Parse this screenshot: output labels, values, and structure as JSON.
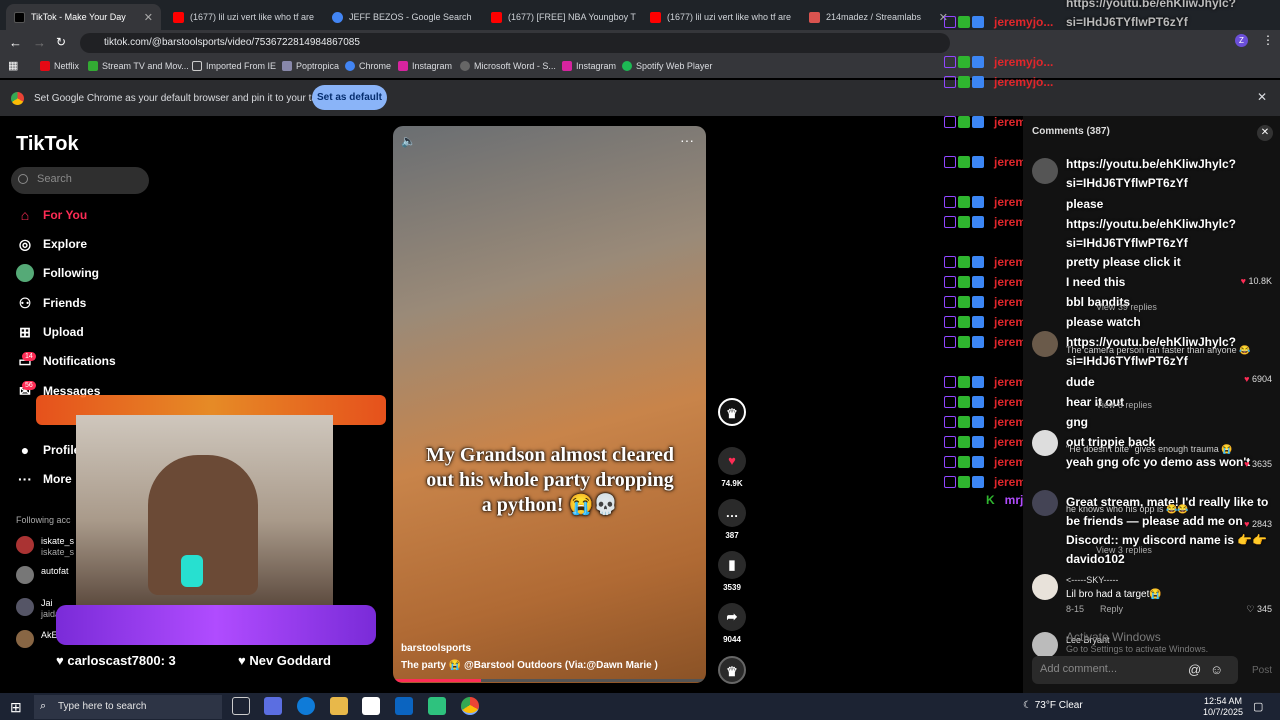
{
  "browser": {
    "tabs": [
      {
        "title": "TikTok - Make Your Day",
        "active": true
      },
      {
        "title": "(1677) lil uzi vert like who tf are"
      },
      {
        "title": "JEFF BEZOS - Google Search"
      },
      {
        "title": "(1677) [FREE] NBA Youngboy T"
      },
      {
        "title": "(1677) lil uzi vert like who tf are"
      },
      {
        "title": "214madez / Streamlabs"
      }
    ],
    "url": "tiktok.com/@barstoolsports/video/7536722814984867085",
    "bookmarks": [
      "Netflix",
      "Stream TV and Mov...",
      "Imported From IE",
      "Poptropica",
      "Chrome",
      "Instagram",
      "Microsoft Word - S...",
      "Instagram",
      "Spotify Web Player"
    ],
    "infobar_text": "Set Google Chrome as your default browser and pin it to your taskbar",
    "infobar_button": "Set as default"
  },
  "tiktok": {
    "logo": "TikTok",
    "search_placeholder": "Search",
    "nav": [
      "For You",
      "Explore",
      "Following",
      "Friends",
      "Upload",
      "Notifications",
      "Messages",
      "Profile",
      "More"
    ],
    "notif_badge": "14",
    "msg_badge": "56",
    "following_header": "Following acc",
    "following": [
      {
        "name": "iskate_s",
        "sub": "iskate_s"
      },
      {
        "name": "autofat",
        "sub": ""
      },
      {
        "name": "Jai",
        "sub": "jaidabunni"
      },
      {
        "name": "AkEatz",
        "sub": ""
      }
    ],
    "video": {
      "caption": "My Grandson almost cleared out his whole party dropping a python! 😭💀",
      "author": "barstoolsports",
      "description": "The party 😭 @Barstool Outdoors  (Via:@Dawn Marie )",
      "likes": "74.9K",
      "comments": "387",
      "saves": "3539",
      "shares": "9044"
    },
    "comments_title": "Comments (387)",
    "comment_items": [
      {
        "text": "https://youtu.be/ehKliwJhylc?si=IHdJ6TYflwPT6zYf"
      },
      {
        "text": "https://youtu.be/ehKliwJhylc?si=IHdJ6TYflwPT6zYf"
      },
      {
        "text": "please"
      },
      {
        "text": "https://youtu.be/ehKliwJhylc?si=IHdJ6TYflwPT6zYf"
      },
      {
        "text": "pretty please click it"
      },
      {
        "text": "I need this"
      },
      {
        "text": "bbl bandits"
      },
      {
        "text": "please watch"
      },
      {
        "text": "https://youtu.be/ehKliwJhylc?si=IHdJ6TYflwPT6zYf"
      },
      {
        "text": "dude"
      },
      {
        "text": "hear it out"
      },
      {
        "text": "gng"
      },
      {
        "text": "out trippie back"
      },
      {
        "text": "yeah gng ofc yo demo ass won't"
      },
      {
        "text": "Great stream, mate! I'd really like to be friends — please add me on Discord:: my discord name is 👉👉 davido102"
      }
    ],
    "comment_meta": [
      {
        "likes": "10.8K",
        "reply": "View 39 replies"
      },
      {
        "line": "The camera person ran faster than anyone 😂",
        "likes": "6904",
        "reply": "View 6 replies"
      },
      {
        "line": "\"He doesn't bite\" gives enough trauma 😭",
        "likes": "3635"
      },
      {
        "line": "he knows who his opp is 😂😂",
        "likes": "2843",
        "reply": "View 3 replies"
      }
    ],
    "last_comment": {
      "user": "<-----SKY-----",
      "text": "Lil bro had a target😭",
      "date": "8-15",
      "reply": "Reply",
      "likes": "345"
    },
    "next_user": "Lee Bryant",
    "watermark": "Activate Windows",
    "watermark_sub": "Go to Settings to activate Windows.",
    "add_comment": "Add comment...",
    "post": "Post"
  },
  "stream_overlay": {
    "chat_user": "jeremyjo...",
    "chat_user2": "mrjerr",
    "alert1": "carloscast7800: 3",
    "alert2": "Nev Goddard"
  },
  "taskbar": {
    "search": "Type here to search",
    "weather": "73°F  Clear",
    "time": "12:54 AM",
    "date": "10/7/2025"
  }
}
